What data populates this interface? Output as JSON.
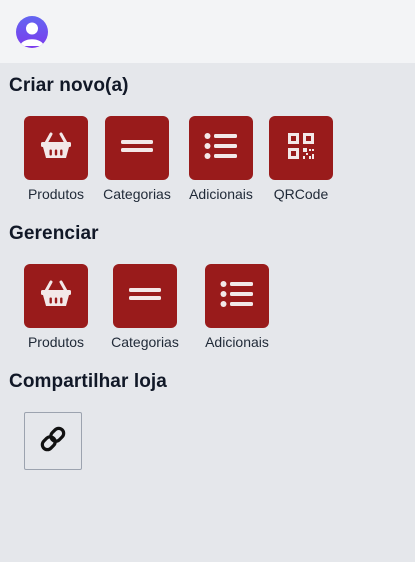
{
  "header": {
    "avatar_icon": "user-avatar-icon"
  },
  "sections": {
    "create": {
      "title": "Criar novo(a)",
      "items": [
        {
          "label": "Produtos",
          "icon": "basket-icon"
        },
        {
          "label": "Categorias",
          "icon": "equals-icon"
        },
        {
          "label": "Adicionais",
          "icon": "list-icon"
        },
        {
          "label": "QRCode",
          "icon": "qrcode-icon"
        }
      ]
    },
    "manage": {
      "title": "Gerenciar",
      "items": [
        {
          "label": "Produtos",
          "icon": "basket-icon"
        },
        {
          "label": "Categorias",
          "icon": "equals-icon"
        },
        {
          "label": "Adicionais",
          "icon": "list-icon"
        }
      ]
    },
    "share": {
      "title": "Compartilhar loja",
      "icon": "link-icon"
    }
  },
  "colors": {
    "tile_bg": "#991b1b",
    "page_bg": "#e5e7eb",
    "header_bg": "#f3f4f6",
    "avatar": "#6366f1"
  }
}
